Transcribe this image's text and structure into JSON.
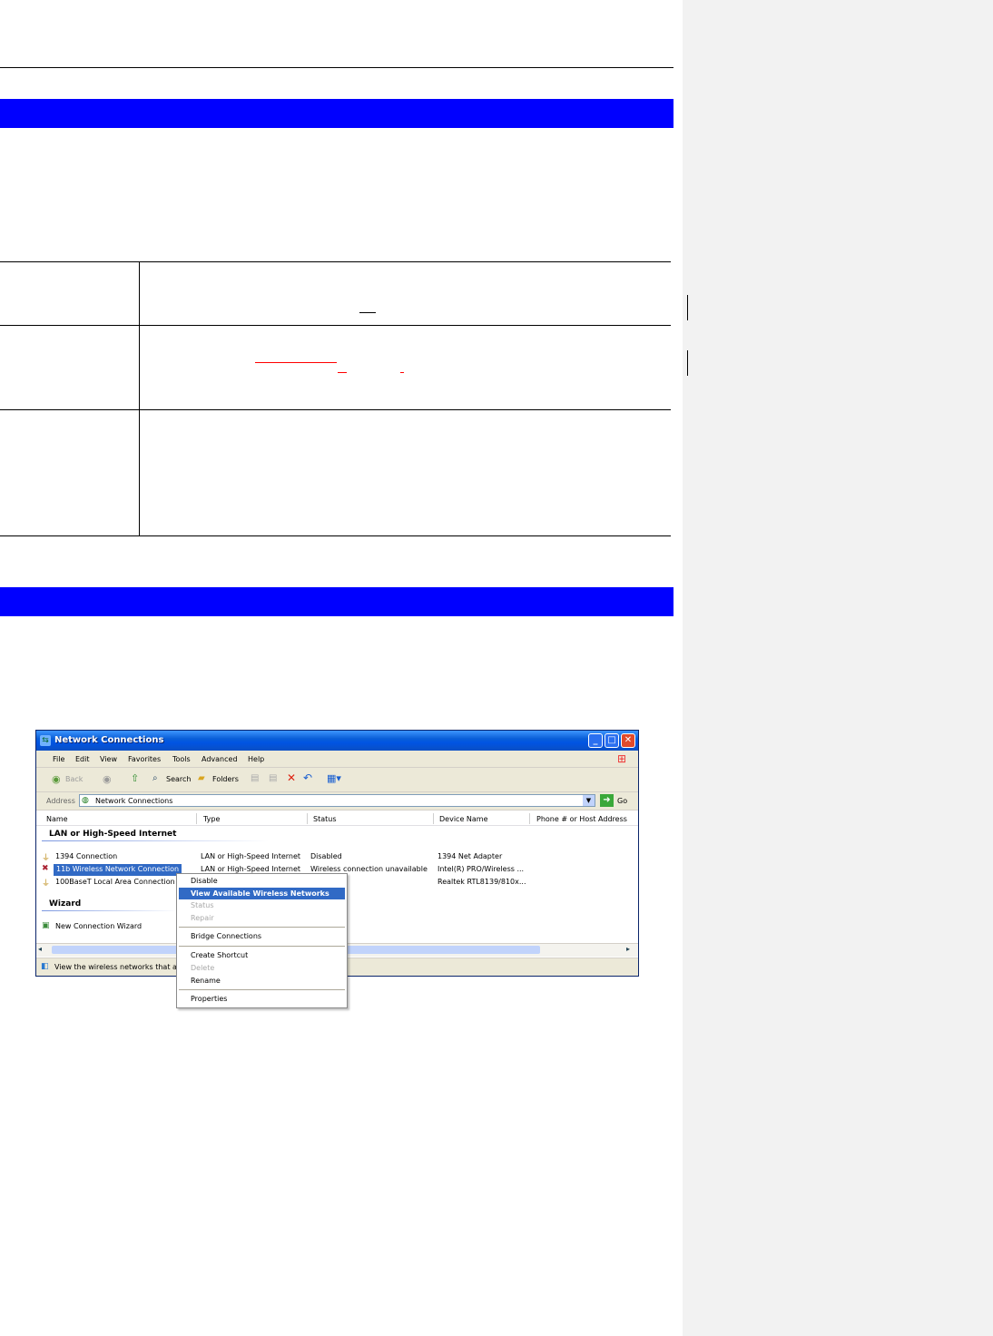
{
  "screenshot": {
    "window_title": "Network Connections",
    "menu": [
      "File",
      "Edit",
      "View",
      "Favorites",
      "Tools",
      "Advanced",
      "Help"
    ],
    "toolbar": {
      "back": "Back",
      "search": "Search",
      "folders": "Folders"
    },
    "address": {
      "label": "Address",
      "value": "Network Connections",
      "go": "Go"
    },
    "columns": [
      "Name",
      "Type",
      "Status",
      "Device Name",
      "Phone # or Host Address"
    ],
    "groups": {
      "lan": {
        "title": "LAN or High-Speed Internet",
        "rows": [
          {
            "name": "1394 Connection",
            "type": "LAN or High-Speed Internet",
            "status": "Disabled",
            "device": "1394 Net Adapter"
          },
          {
            "name": "11b Wireless Network Connection",
            "type": "LAN or High-Speed Internet",
            "status": "Wireless connection unavailable",
            "device": "Intel(R) PRO/Wireless ..."
          },
          {
            "name": "100BaseT Local Area Connection",
            "type": "",
            "status": "",
            "device": "Realtek RTL8139/810x..."
          }
        ]
      },
      "wizard": {
        "title": "Wizard",
        "rows": [
          {
            "name": "New Connection Wizard"
          }
        ]
      }
    },
    "status_text": "View the wireless networks that are",
    "context_menu": {
      "disable": "Disable",
      "view_networks": "View Available Wireless Networks",
      "status": "Status",
      "repair": "Repair",
      "bridge": "Bridge Connections",
      "create_shortcut": "Create Shortcut",
      "delete": "Delete",
      "rename": "Rename",
      "properties": "Properties"
    }
  },
  "colors": {
    "section_bar": "#0000ff",
    "xp_title": "#0054e3",
    "highlight": "#316ac5"
  },
  "icons": [
    "network-icon",
    "lan-icon",
    "wireless-icon",
    "wizard-icon",
    "windows-logo-icon",
    "back-icon",
    "forward-icon",
    "up-icon",
    "search-icon",
    "folder-icon",
    "delete-icon",
    "undo-icon",
    "views-icon",
    "go-icon",
    "info-icon"
  ]
}
